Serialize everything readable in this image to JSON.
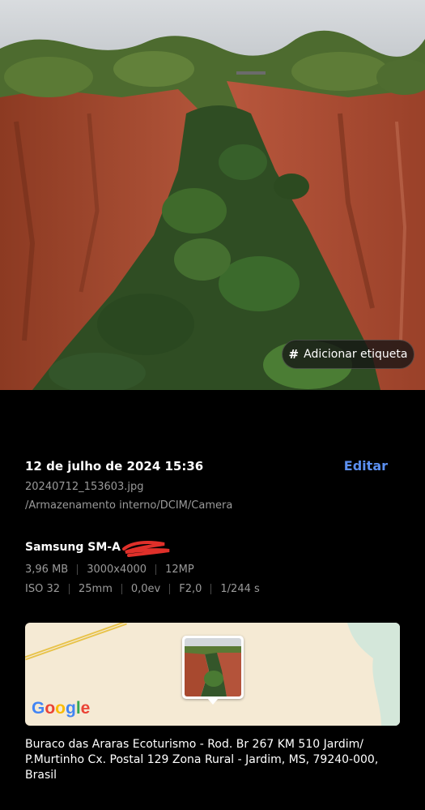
{
  "photo": {
    "tag_button_label": "# Adicionar etiqueta",
    "tag_hash": "#",
    "tag_text": "Adicionar etiqueta"
  },
  "details": {
    "date_time": "12 de julho de 2024 15:36",
    "edit_label": "Editar",
    "filename": "20240712_153603.jpg",
    "path": "/Armazenamento interno/DCIM/Camera",
    "device": "Samsung SM-A",
    "specs_row1": [
      "3,96 MB",
      "3000x4000",
      "12MP"
    ],
    "specs_row2": [
      "ISO 32",
      "25mm",
      "0,0ev",
      "F2,0",
      "1/244 s"
    ]
  },
  "map": {
    "logo_letters": [
      "G",
      "o",
      "o",
      "g",
      "l",
      "e"
    ]
  },
  "location": {
    "address": "Buraco das Araras Ecoturismo - Rod. Br 267 KM 510 Jardim/ P.Murtinho Cx. Postal 129 Zona Rural - Jardim, MS, 79240-000, Brasil"
  },
  "colors": {
    "accent": "#5b8ff0",
    "background": "#000000",
    "secondary_text": "#9a9a9a"
  }
}
